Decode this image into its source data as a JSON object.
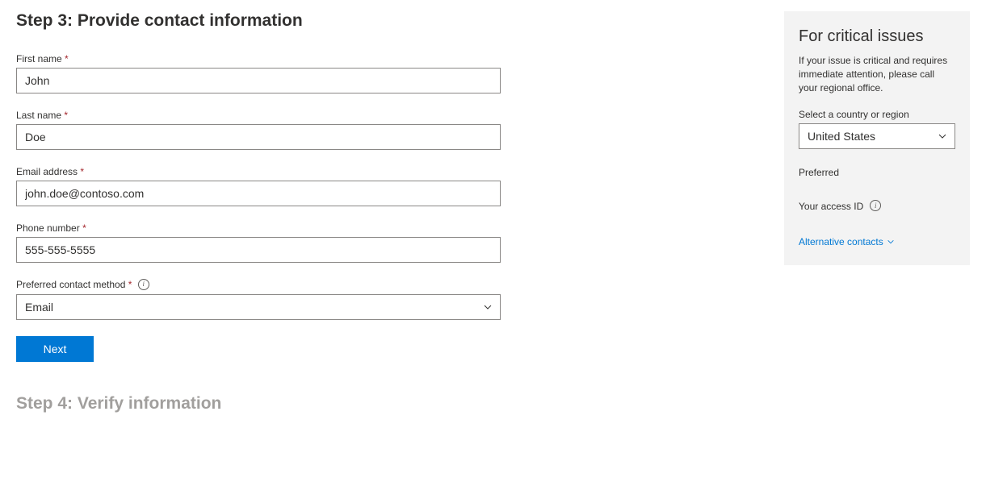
{
  "main": {
    "step3_heading": "Step 3: Provide contact information",
    "step4_heading": "Step 4: Verify information",
    "fields": {
      "first_name": {
        "label": "First name",
        "required": "*",
        "value": "John"
      },
      "last_name": {
        "label": "Last name",
        "required": "*",
        "value": "Doe"
      },
      "email": {
        "label": "Email address",
        "required": "*",
        "value": "john.doe@contoso.com"
      },
      "phone": {
        "label": "Phone number",
        "required": "*",
        "value": "555-555-5555"
      },
      "contact_method": {
        "label": "Preferred contact method",
        "required": "*",
        "value": "Email"
      }
    },
    "next_button": "Next"
  },
  "sidebar": {
    "heading": "For critical issues",
    "description": "If your issue is critical and requires immediate attention, please call your regional office.",
    "country_label": "Select a country or region",
    "country_value": "United States",
    "preferred_label": "Preferred",
    "access_id_label": "Your access ID",
    "alt_contacts_link": "Alternative contacts"
  }
}
